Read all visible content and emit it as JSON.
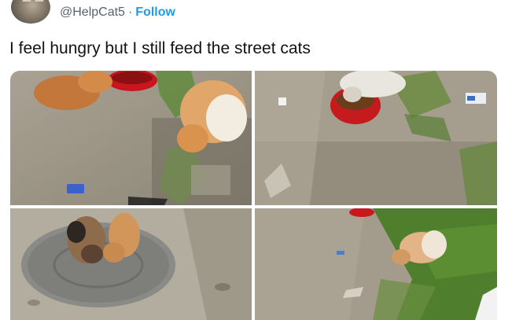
{
  "tweet": {
    "handle": "@HelpCat5",
    "separator": "·",
    "follow_label": "Follow",
    "text": "I feel hungry but I still feed the street cats"
  },
  "colors": {
    "accent": "#1d9bf0",
    "secondary_text": "#536471",
    "primary_text": "#0f1419"
  },
  "icons": {
    "avatar": "cat-avatar"
  }
}
